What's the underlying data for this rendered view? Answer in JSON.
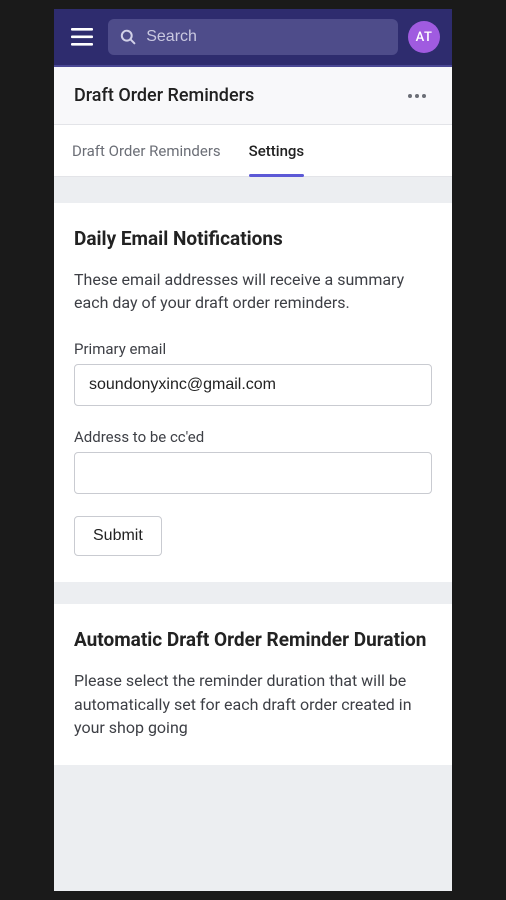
{
  "topbar": {
    "search_placeholder": "Search",
    "avatar_initials": "AT"
  },
  "header": {
    "title": "Draft Order Reminders"
  },
  "tabs": [
    {
      "label": "Draft Order Reminders",
      "active": false
    },
    {
      "label": "Settings",
      "active": true
    }
  ],
  "cards": {
    "email_notifications": {
      "title": "Daily Email Notifications",
      "description": "These email addresses will receive a summary each day of your draft order reminders.",
      "primary_label": "Primary email",
      "primary_value": "soundonyxinc@gmail.com",
      "cc_label": "Address to be cc'ed",
      "cc_value": "",
      "submit_label": "Submit"
    },
    "auto_duration": {
      "title": "Automatic Draft Order Reminder Duration",
      "description": "Please select the reminder duration that will be automatically set for each draft order created in your shop going"
    }
  }
}
